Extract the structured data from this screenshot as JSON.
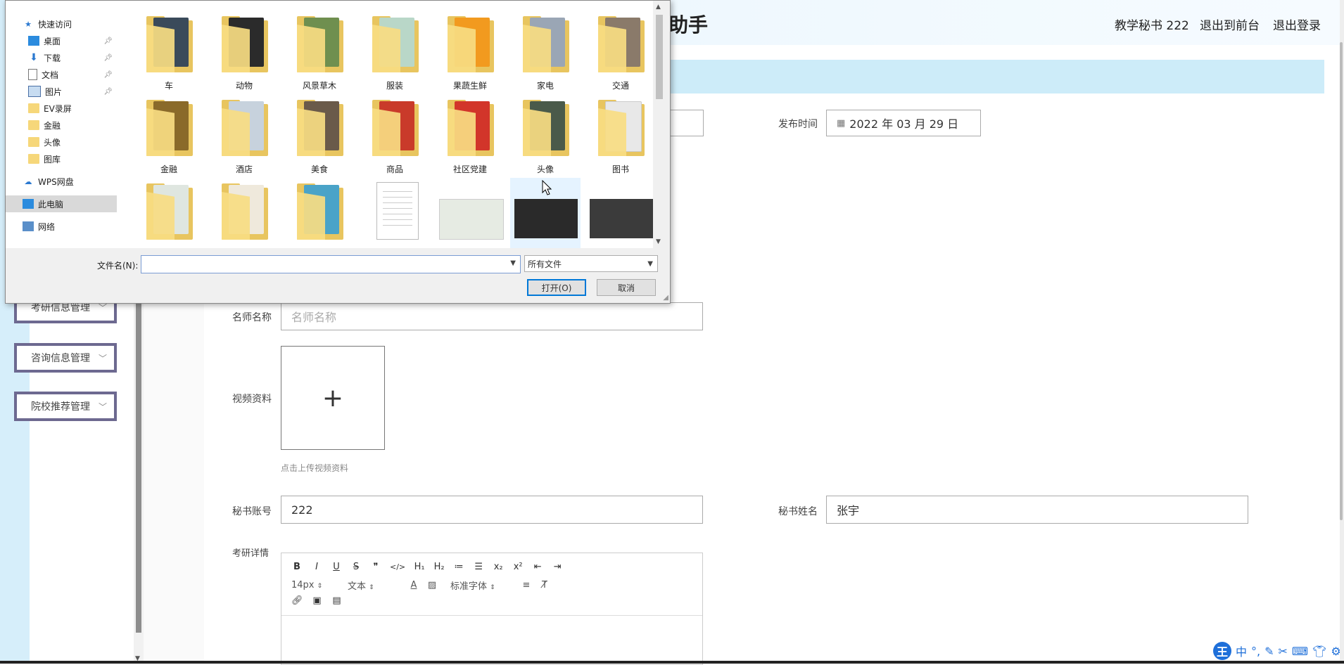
{
  "app": {
    "title_fragment": "助手",
    "header_links": [
      "教学秘书 222",
      "退出到前台",
      "退出登录"
    ],
    "sidebar_menu": [
      {
        "label": "考研信息管理"
      },
      {
        "label": "咨询信息管理"
      },
      {
        "label": "院校推荐管理"
      }
    ]
  },
  "form": {
    "publish_time": {
      "label": "发布时间",
      "value": "2022 年 03 月 29 日"
    },
    "teacher_name": {
      "label": "名师名称",
      "placeholder": "名师名称"
    },
    "video": {
      "label": "视频资料",
      "plus": "+",
      "hint": "点击上传视频资料"
    },
    "secretary_account": {
      "label": "秘书账号",
      "value": "222"
    },
    "secretary_name": {
      "label": "秘书姓名",
      "value": "张宇"
    },
    "details": {
      "label": "考研详情"
    }
  },
  "editor": {
    "row1": [
      "B",
      "I",
      "U",
      "S",
      "❞",
      "</>",
      "H₁",
      "H₂",
      "≔",
      "☰",
      "x₂",
      "x²",
      "⇤",
      "⇥"
    ],
    "font_size": "14px",
    "block_type": "文本",
    "font_family": "标准字体"
  },
  "dialog": {
    "nav": [
      {
        "label": "快速访问",
        "icon": "star-icon"
      },
      {
        "label": "桌面",
        "icon": "desktop-icon",
        "pinned": true
      },
      {
        "label": "下载",
        "icon": "download-icon",
        "pinned": true
      },
      {
        "label": "文档",
        "icon": "document-icon",
        "pinned": true
      },
      {
        "label": "图片",
        "icon": "picture-icon",
        "pinned": true
      },
      {
        "label": "EV录屏",
        "icon": "folder-icon"
      },
      {
        "label": "金融",
        "icon": "folder-icon"
      },
      {
        "label": "头像",
        "icon": "folder-icon"
      },
      {
        "label": "图库",
        "icon": "folder-icon"
      },
      {
        "label": "WPS网盘",
        "icon": "cloud-icon"
      },
      {
        "label": "此电脑",
        "icon": "computer-icon",
        "selected": true
      },
      {
        "label": "网络",
        "icon": "network-icon"
      }
    ],
    "folders_row1": [
      {
        "label": "车",
        "color": "#3a4a5a"
      },
      {
        "label": "动物",
        "color": "#2b2b2b"
      },
      {
        "label": "风景草木",
        "color": "#6f8f4f"
      },
      {
        "label": "服装",
        "color": "#b9d7c8"
      },
      {
        "label": "果蔬生鲜",
        "color": "#f29a1f"
      },
      {
        "label": "家电",
        "color": "#9aa6b5"
      },
      {
        "label": "交通",
        "color": "#8a7a6a"
      }
    ],
    "folders_row2": [
      {
        "label": "金融",
        "color": "#8a6a2a"
      },
      {
        "label": "酒店",
        "color": "#c7d2dd"
      },
      {
        "label": "美食",
        "color": "#6a5a4a"
      },
      {
        "label": "商品",
        "color": "#c93a2a"
      },
      {
        "label": "社区党建",
        "color": "#d2352a"
      },
      {
        "label": "头像",
        "color": "#4a5a4a"
      },
      {
        "label": "图书",
        "color": "#e8e8e8"
      }
    ],
    "filename_label": "文件名(N):",
    "filename_value": "",
    "filter": "所有文件",
    "open_button": "打开(O)",
    "cancel_button": "取消"
  },
  "ime": {
    "logo": "王",
    "mode": "中"
  }
}
